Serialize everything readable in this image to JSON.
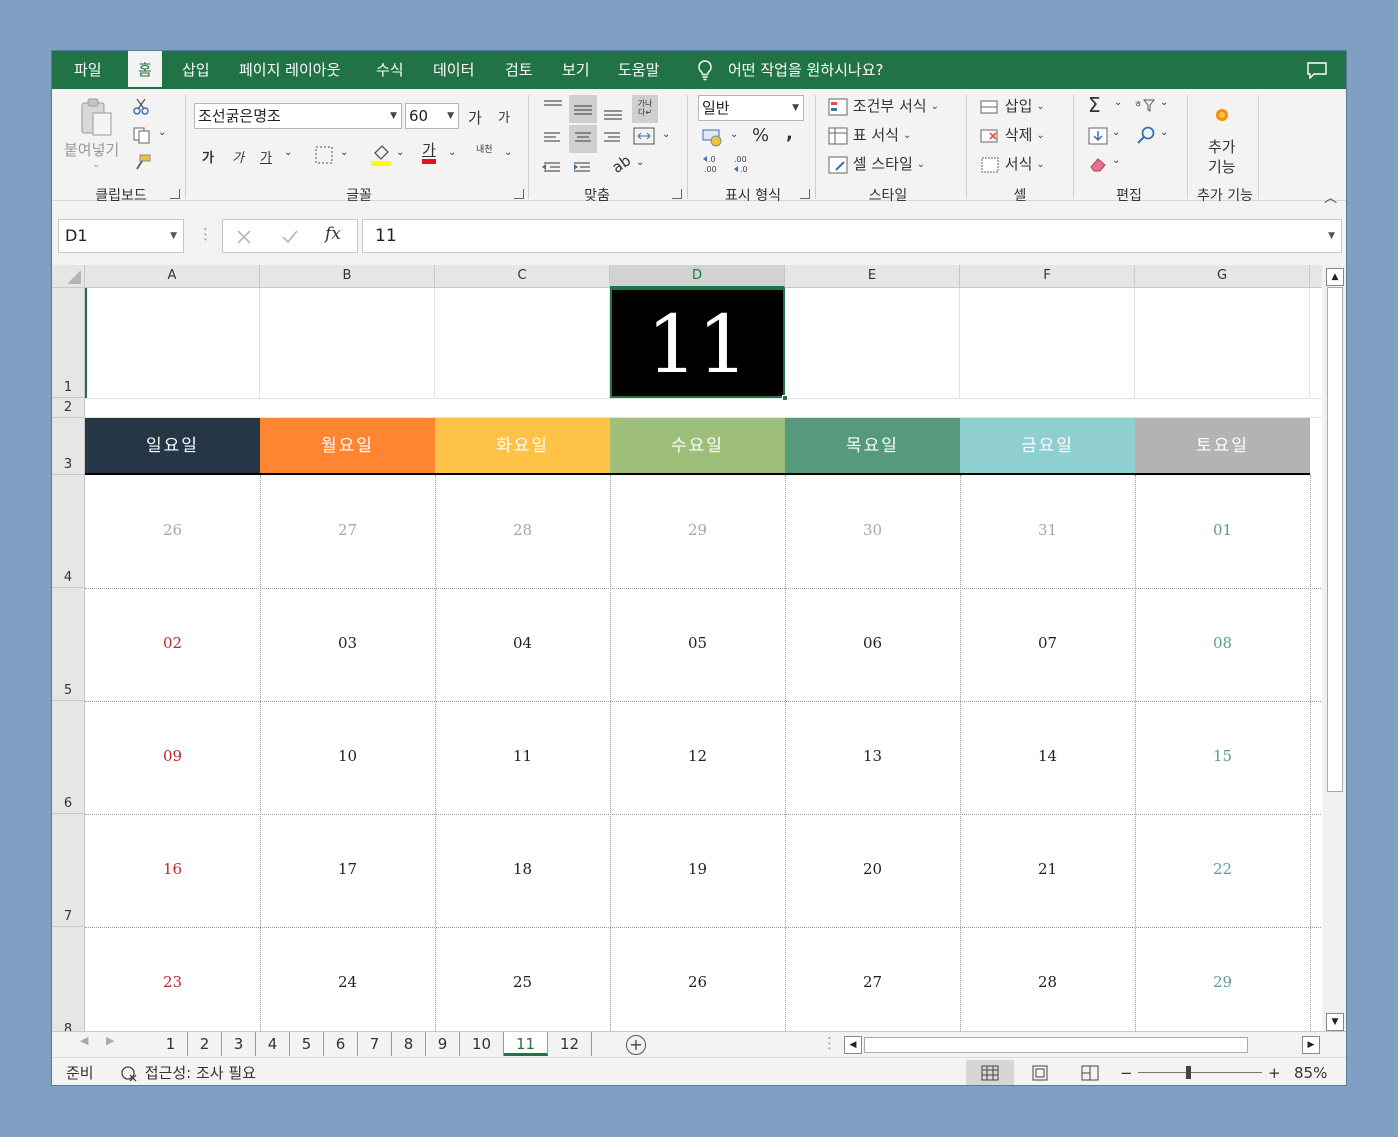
{
  "tabs": [
    "파일",
    "홈",
    "삽입",
    "페이지 레이아웃",
    "수식",
    "데이터",
    "검토",
    "보기",
    "도움말"
  ],
  "tell_me": "어떤 작업을 원하시나요?",
  "ribbon": {
    "clipboard": {
      "paste": "붙여넣기",
      "label": "클립보드"
    },
    "font": {
      "name": "조선굵은명조",
      "size": "60",
      "bold": "가",
      "italic": "가",
      "underline": "가",
      "grow": "가",
      "shrink": "가",
      "color_glyph": "가",
      "phonetic": "내천",
      "label": "글꼴"
    },
    "alignment": {
      "label": "맞춤",
      "wrap": "가나\n다↵"
    },
    "number": {
      "format": "일반",
      "percent": "%",
      "comma": ",",
      "inc": ".00",
      "label": "표시 형식"
    },
    "styles": {
      "conditional": "조건부 서식",
      "table": "표 서식",
      "cell": "셀 스타일",
      "label": "스타일"
    },
    "cells": {
      "insert": "삽입",
      "delete": "삭제",
      "format": "서식",
      "label": "셀"
    },
    "editing": {
      "label": "편집"
    },
    "addins": {
      "button_line1": "추가",
      "button_line2": "기능",
      "label": "추가 기능"
    }
  },
  "namebox": "D1",
  "formula": "11",
  "columns": [
    "A",
    "B",
    "C",
    "D",
    "E",
    "F",
    "G"
  ],
  "rows": [
    "1",
    "2",
    "3",
    "4",
    "5",
    "6",
    "7",
    "8"
  ],
  "title_value": "11",
  "weekdays": [
    "일요일",
    "월요일",
    "화요일",
    "수요일",
    "목요일",
    "금요일",
    "토요일"
  ],
  "weekday_colors": [
    "#253746",
    "#ff8533",
    "#fec246",
    "#9dbf7a",
    "#56997c",
    "#8fcfcf",
    "#b4b3b3"
  ],
  "weeks": [
    [
      "26",
      "27",
      "28",
      "29",
      "30",
      "31",
      "01"
    ],
    [
      "02",
      "03",
      "04",
      "05",
      "06",
      "07",
      "08"
    ],
    [
      "09",
      "10",
      "11",
      "12",
      "13",
      "14",
      "15"
    ],
    [
      "16",
      "17",
      "18",
      "19",
      "20",
      "21",
      "22"
    ],
    [
      "23",
      "24",
      "25",
      "26",
      "27",
      "28",
      "29"
    ]
  ],
  "colors": {
    "sunday": "#c0272d",
    "saturday": "#5c9b94",
    "weekday": "#222222",
    "outside": "#a6a6a6",
    "excel_green": "#217346"
  },
  "sheets": [
    "1",
    "2",
    "3",
    "4",
    "5",
    "6",
    "7",
    "8",
    "9",
    "10",
    "11",
    "12"
  ],
  "active_sheet": "11",
  "status": {
    "ready": "준비",
    "accessibility": "접근성: 조사 필요",
    "zoom": "85%"
  }
}
